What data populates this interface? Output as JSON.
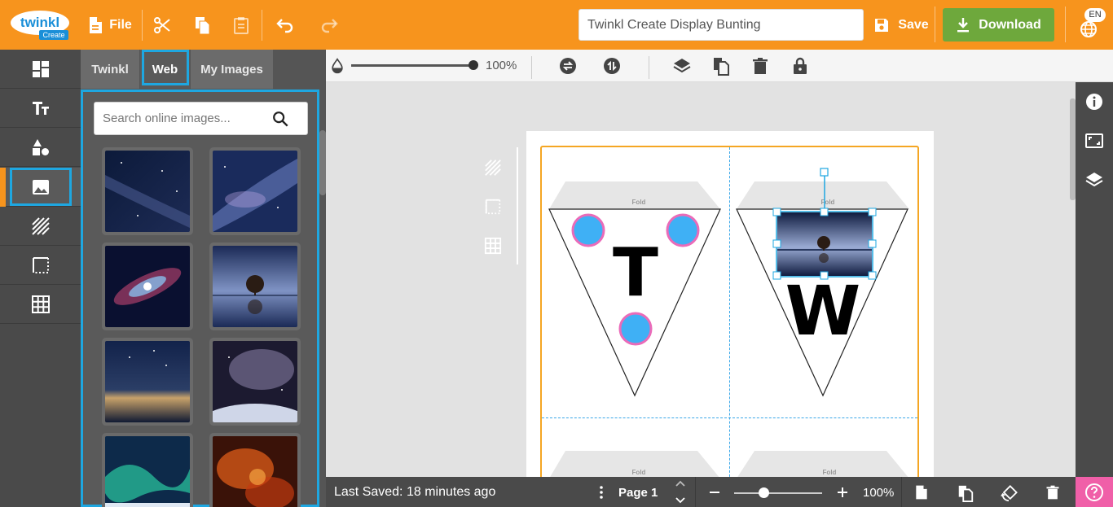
{
  "app": {
    "logo_text": "twinkl",
    "logo_sub": "Create"
  },
  "topbar": {
    "file_label": "File",
    "document_title": "Twinkl Create Display Bunting",
    "save_label": "Save",
    "download_label": "Download",
    "language": "EN"
  },
  "panel": {
    "tabs": [
      {
        "label": "Twinkl"
      },
      {
        "label": "Web"
      },
      {
        "label": "My Images"
      }
    ],
    "search_placeholder": "Search online images..."
  },
  "toolbar": {
    "opacity_value": "100%"
  },
  "canvas": {
    "fold_label": "Fold",
    "letters": [
      "T",
      "W"
    ]
  },
  "statusbar": {
    "last_saved": "Last Saved: 18 minutes ago",
    "page_label": "Page 1",
    "zoom_value": "100%"
  },
  "colors": {
    "brand": "#f7941d",
    "download": "#6ea83c",
    "selection": "#1ea7e1",
    "dot_fill": "#3fb0f5",
    "dot_stroke": "#ea6bb9",
    "help": "#f05fa8"
  }
}
